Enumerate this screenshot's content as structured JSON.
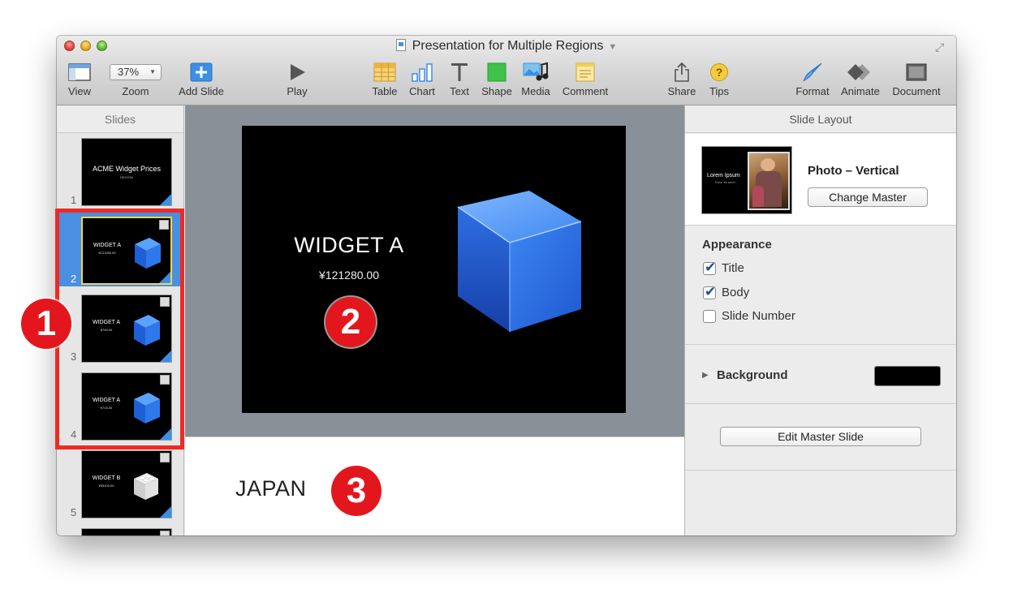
{
  "window": {
    "title": "Presentation for Multiple Regions"
  },
  "toolbar": {
    "view": "View",
    "zoom_value": "37%",
    "zoom": "Zoom",
    "add_slide": "Add Slide",
    "play": "Play",
    "table": "Table",
    "chart": "Chart",
    "text": "Text",
    "shape": "Shape",
    "media": "Media",
    "comment": "Comment",
    "share": "Share",
    "tips": "Tips",
    "format": "Format",
    "animate": "Animate",
    "document": "Document"
  },
  "slides_panel": {
    "header": "Slides",
    "items": [
      {
        "number": "1",
        "title": "ACME Widget Prices",
        "subtitle": "REGION"
      },
      {
        "number": "2",
        "title": "WIDGET A",
        "subtitle": "¥121280.00"
      },
      {
        "number": "3",
        "title": "WIDGET A",
        "subtitle": "$799.00"
      },
      {
        "number": "4",
        "title": "WIDGET A",
        "subtitle": "€715.00"
      },
      {
        "number": "5",
        "title": "WIDGET B",
        "subtitle": "¥95100.00"
      }
    ]
  },
  "slide": {
    "title": "WIDGET A",
    "price": "¥121280.00"
  },
  "notes": {
    "text": "JAPAN"
  },
  "inspector": {
    "header": "Slide Layout",
    "master_thumb_title": "Lorem Ipsum",
    "master_thumb_sub": "Dolor sit amet",
    "layout_name": "Photo – Vertical",
    "change_master": "Change Master",
    "appearance": {
      "title": "Appearance",
      "options": [
        {
          "label": "Title",
          "checked": true
        },
        {
          "label": "Body",
          "checked": true
        },
        {
          "label": "Slide Number",
          "checked": false
        }
      ]
    },
    "background_label": "Background",
    "background_color": "#000000",
    "edit_master": "Edit Master Slide"
  },
  "callouts": [
    "1",
    "2",
    "3"
  ],
  "colors": {
    "accent": "#4a8fe0",
    "callout_red": "#e4161d"
  }
}
